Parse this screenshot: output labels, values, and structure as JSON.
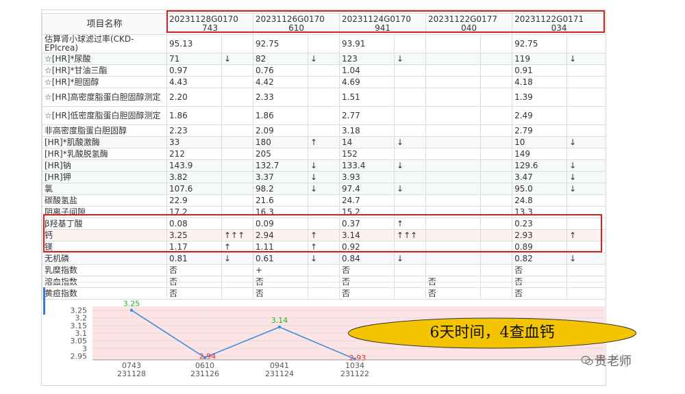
{
  "table": {
    "header": {
      "name_label": "项目名称",
      "dates": [
        [
          "20231128G0170",
          "743"
        ],
        [
          "20231126G0170",
          "610"
        ],
        [
          "20231124G0170",
          "941"
        ],
        [
          "20231122G0177",
          "040"
        ],
        [
          "20231122G0171",
          "034"
        ]
      ]
    },
    "rows": [
      {
        "name": "估算肾小球滤过率(CKD-EPIcrea)",
        "tall": true,
        "shade": false,
        "cells": [
          [
            "95.13",
            "",
            ""
          ],
          [
            "92.75",
            "",
            ""
          ],
          [
            "93.91",
            "",
            ""
          ],
          [
            "",
            "",
            ""
          ],
          [
            "92.75",
            "",
            ""
          ]
        ]
      },
      {
        "name": "☆[HR]*尿酸",
        "tall": false,
        "shade": true,
        "cells": [
          [
            "71",
            "↓",
            "blue"
          ],
          [
            "82",
            "↓",
            "blue"
          ],
          [
            "123",
            "↓",
            "blue"
          ],
          [
            "",
            "",
            ""
          ],
          [
            "119",
            "↓",
            "blue"
          ]
        ]
      },
      {
        "name": "☆[HR]*甘油三酯",
        "tall": false,
        "shade": false,
        "cells": [
          [
            "0.97",
            "",
            ""
          ],
          [
            "0.76",
            "",
            ""
          ],
          [
            "1.04",
            "",
            ""
          ],
          [
            "",
            "",
            ""
          ],
          [
            "0.91",
            "",
            ""
          ]
        ]
      },
      {
        "name": "☆[HR]*胆固醇",
        "tall": false,
        "shade": false,
        "cells": [
          [
            "4.43",
            "",
            ""
          ],
          [
            "4.42",
            "",
            ""
          ],
          [
            "4.69",
            "",
            ""
          ],
          [
            "",
            "",
            ""
          ],
          [
            "4.18",
            "",
            ""
          ]
        ]
      },
      {
        "name": "☆[HR]高密度脂蛋白胆固醇测定",
        "tall": true,
        "shade": false,
        "cells": [
          [
            "2.20",
            "",
            ""
          ],
          [
            "2.33",
            "",
            ""
          ],
          [
            "1.51",
            "",
            ""
          ],
          [
            "",
            "",
            ""
          ],
          [
            "1.39",
            "",
            ""
          ]
        ]
      },
      {
        "name": "☆[HR]低密度脂蛋白胆固醇测定",
        "tall": true,
        "shade": false,
        "cells": [
          [
            "1.86",
            "",
            ""
          ],
          [
            "1.86",
            "",
            ""
          ],
          [
            "2.77",
            "",
            ""
          ],
          [
            "",
            "",
            ""
          ],
          [
            "2.49",
            "",
            ""
          ]
        ]
      },
      {
        "name": "非高密度脂蛋白胆固醇",
        "tall": false,
        "shade": false,
        "cells": [
          [
            "2.23",
            "",
            ""
          ],
          [
            "2.09",
            "",
            ""
          ],
          [
            "3.18",
            "",
            ""
          ],
          [
            "",
            "",
            ""
          ],
          [
            "2.79",
            "",
            ""
          ]
        ]
      },
      {
        "name": "[HR]*肌酸激酶",
        "tall": false,
        "shade": true,
        "cells": [
          [
            "33",
            "",
            ""
          ],
          [
            "180",
            "↑",
            "red"
          ],
          [
            "14",
            "↓",
            "blue"
          ],
          [
            "",
            "",
            ""
          ],
          [
            "10",
            "↓",
            "blue"
          ]
        ]
      },
      {
        "name": "[HR]*乳酸脱氢酶",
        "tall": false,
        "shade": false,
        "cells": [
          [
            "212",
            "",
            ""
          ],
          [
            "205",
            "",
            ""
          ],
          [
            "152",
            "",
            ""
          ],
          [
            "",
            "",
            ""
          ],
          [
            "149",
            "",
            ""
          ]
        ]
      },
      {
        "name": "[HR]钠",
        "tall": false,
        "shade": true,
        "cells": [
          [
            "143.9",
            "",
            ""
          ],
          [
            "132.7",
            "↓",
            "blue"
          ],
          [
            "133.4",
            "↓",
            "blue"
          ],
          [
            "",
            "",
            ""
          ],
          [
            "129.6",
            "↓",
            "blue"
          ]
        ]
      },
      {
        "name": "[HR]钾",
        "tall": false,
        "shade": true,
        "cells": [
          [
            "3.82",
            "",
            ""
          ],
          [
            "3.37",
            "↓",
            "blue"
          ],
          [
            "3.93",
            "",
            ""
          ],
          [
            "",
            "",
            ""
          ],
          [
            "3.47",
            "↓",
            "blue"
          ]
        ]
      },
      {
        "name": "氯",
        "tall": false,
        "shade": true,
        "cells": [
          [
            "107.6",
            "",
            ""
          ],
          [
            "98.2",
            "↓",
            "blue"
          ],
          [
            "97.4",
            "↓",
            "blue"
          ],
          [
            "",
            "",
            ""
          ],
          [
            "95.0",
            "↓",
            "blue"
          ]
        ]
      },
      {
        "name": "碳酸氢盐",
        "tall": false,
        "shade": false,
        "cells": [
          [
            "22.9",
            "",
            ""
          ],
          [
            "21.6",
            "",
            ""
          ],
          [
            "24.7",
            "",
            ""
          ],
          [
            "",
            "",
            ""
          ],
          [
            "24.8",
            "",
            ""
          ]
        ]
      },
      {
        "name": "阴离子间隙",
        "tall": false,
        "shade": false,
        "cells": [
          [
            "17.2",
            "",
            ""
          ],
          [
            "16.3",
            "",
            ""
          ],
          [
            "15.2",
            "",
            ""
          ],
          [
            "",
            "",
            ""
          ],
          [
            "13.3",
            "",
            ""
          ]
        ]
      },
      {
        "name": "β羟基丁酸",
        "tall": false,
        "shade": false,
        "cells": [
          [
            "0.08",
            "",
            ""
          ],
          [
            "0.09",
            "",
            ""
          ],
          [
            "0.37",
            "↑",
            "red"
          ],
          [
            "",
            "",
            ""
          ],
          [
            "0.23",
            "",
            ""
          ]
        ]
      },
      {
        "name": "钙",
        "tall": false,
        "shade": false,
        "pink": true,
        "cells": [
          [
            "3.25",
            "↑↑↑",
            "green"
          ],
          [
            "2.94",
            "↑",
            "red"
          ],
          [
            "3.14",
            "↑↑↑",
            "green"
          ],
          [
            "",
            "",
            ""
          ],
          [
            "2.93",
            "↑",
            "red"
          ]
        ]
      },
      {
        "name": "镁",
        "tall": false,
        "shade": false,
        "cells": [
          [
            "1.17",
            "↑",
            "red"
          ],
          [
            "1.11",
            "↑",
            "red"
          ],
          [
            "0.92",
            "",
            ""
          ],
          [
            "",
            "",
            ""
          ],
          [
            "0.89",
            "",
            ""
          ]
        ]
      },
      {
        "name": "无机磷",
        "tall": false,
        "shade": true,
        "cells": [
          [
            "0.81",
            "↓",
            "blue"
          ],
          [
            "0.61",
            "↓",
            "blue"
          ],
          [
            "0.84",
            "↓",
            "blue"
          ],
          [
            "",
            "",
            ""
          ],
          [
            "0.82",
            "↓",
            "blue"
          ]
        ]
      },
      {
        "name": "乳糜指数",
        "tall": false,
        "shade": false,
        "cells": [
          [
            "否",
            "",
            ""
          ],
          [
            "+",
            "",
            ""
          ],
          [
            "否",
            "",
            ""
          ],
          [
            "",
            "",
            ""
          ],
          [
            "否",
            "",
            ""
          ]
        ]
      },
      {
        "name": "溶血指数",
        "tall": false,
        "shade": false,
        "cells": [
          [
            "否",
            "",
            ""
          ],
          [
            "否",
            "",
            ""
          ],
          [
            "否",
            "",
            ""
          ],
          [
            "否",
            "",
            ""
          ],
          [
            "否",
            "",
            ""
          ]
        ]
      },
      {
        "name": "黄疸指数",
        "tall": false,
        "shade": false,
        "cells": [
          [
            "否",
            "",
            ""
          ],
          [
            "否",
            "",
            ""
          ],
          [
            "否",
            "",
            ""
          ],
          [
            "否",
            "",
            ""
          ],
          [
            "否",
            "",
            ""
          ]
        ]
      }
    ]
  },
  "chart_data": {
    "type": "line",
    "x": [
      "0743\n231128",
      "0610\n231126",
      "0941\n231124",
      "1034\n231122"
    ],
    "x_top": [
      "0743",
      "0610",
      "0941",
      "1034"
    ],
    "x_bottom": [
      "231128",
      "231126",
      "231124",
      "231122"
    ],
    "values": [
      3.25,
      2.94,
      3.14,
      2.93
    ],
    "value_labels": [
      "3.25",
      "2.94",
      "3.14",
      "2.93"
    ],
    "value_label_colors": [
      "#22b422",
      "#e03030",
      "#22b422",
      "#e03030"
    ],
    "y_ticks": [
      "3.25",
      "3.2",
      "3.15",
      "3.1",
      "3.05",
      "3",
      "2.95"
    ],
    "ylim": [
      2.925,
      3.275
    ],
    "line_color": "#3a8fe0",
    "band_color": "#fde3e3",
    "grid": true
  },
  "callout": {
    "text": "6天时间，4查血钙",
    "fill": "#f5c400"
  },
  "watermark": {
    "text": "贵老师"
  },
  "colors": {
    "highlight_box": "#d61f1f",
    "low": "#2a6fd6",
    "high": "#e03030",
    "critical": "#22b422"
  }
}
